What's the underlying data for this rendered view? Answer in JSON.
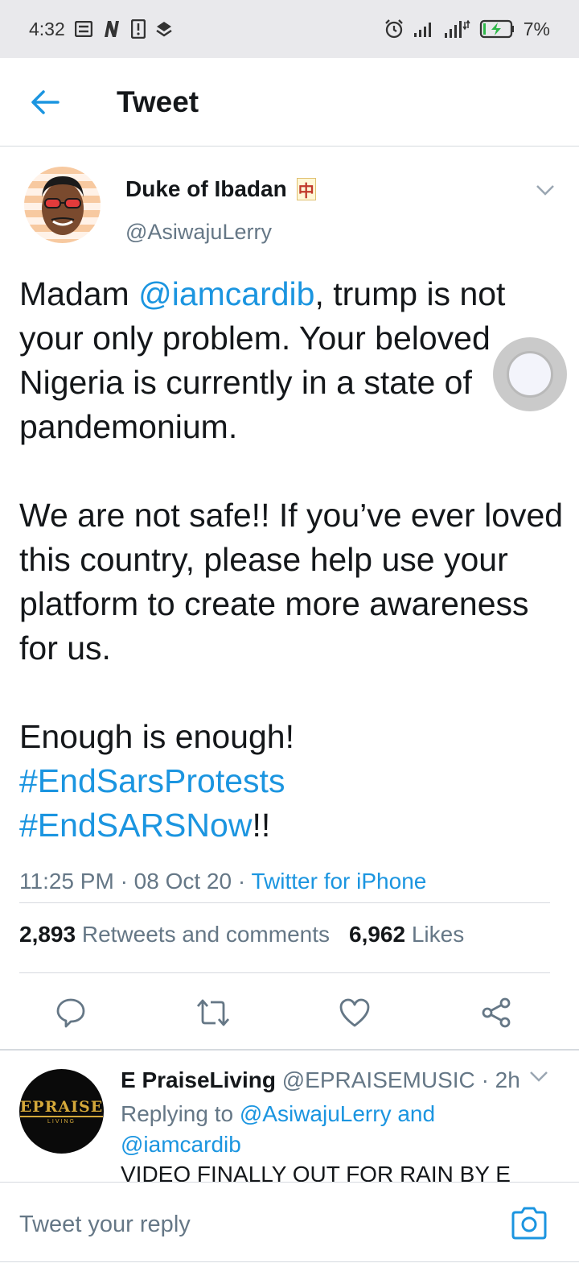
{
  "status_bar": {
    "time": "4:32",
    "battery_percent": "7%",
    "left_icons": [
      "notes-icon",
      "n-app-icon",
      "alert-icon",
      "layers-icon"
    ],
    "right_icons": [
      "alarm-icon",
      "signal-icon",
      "data-signal-icon",
      "battery-charging-icon"
    ]
  },
  "header": {
    "title": "Tweet"
  },
  "tweet": {
    "author": {
      "name": "Duke of Ibadan",
      "badge": "中",
      "handle": "@AsiwajuLerry"
    },
    "text": {
      "p1_before": "Madam ",
      "p1_mention": "@iamcardib",
      "p1_after": ", trump is not your only problem. Your beloved Nigeria is currently in a state of pandemonium.",
      "p2": "We are not safe!! If you’ve ever loved this country, please help use your platform to create more awareness for us.",
      "p3": "Enough is enough!",
      "hashtag1": "#EndSarsProtests",
      "hashtag2": "#EndSARSNow",
      "hashtag2_suffix": "!!"
    },
    "time": "11:25 PM",
    "date": "08 Oct 20",
    "separator": "·",
    "source": "Twitter for iPhone",
    "stats": {
      "retweets_count": "2,893",
      "retweets_label": "Retweets and comments",
      "likes_count": "6,962",
      "likes_label": "Likes"
    }
  },
  "reply": {
    "name": "E PraiseLiving",
    "handle": "@EPRAISEMUSIC",
    "separator": "·",
    "age": "2h",
    "replying_prefix": "Replying to ",
    "replying_handle1": "@AsiwajuLerry",
    "replying_and": " and",
    "replying_handle2": "@iamcardib",
    "body_preview": "VIDEO FINALLY OUT FOR RAIN BY E",
    "avatar_text": "EPRAISE",
    "avatar_subtext": "LIVING"
  },
  "compose": {
    "placeholder": "Tweet your reply"
  },
  "colors": {
    "link": "#1b95e0",
    "muted": "#657786",
    "text": "#14171a",
    "divider": "#d6dadf",
    "status_bar_bg": "#e9e9ec"
  }
}
